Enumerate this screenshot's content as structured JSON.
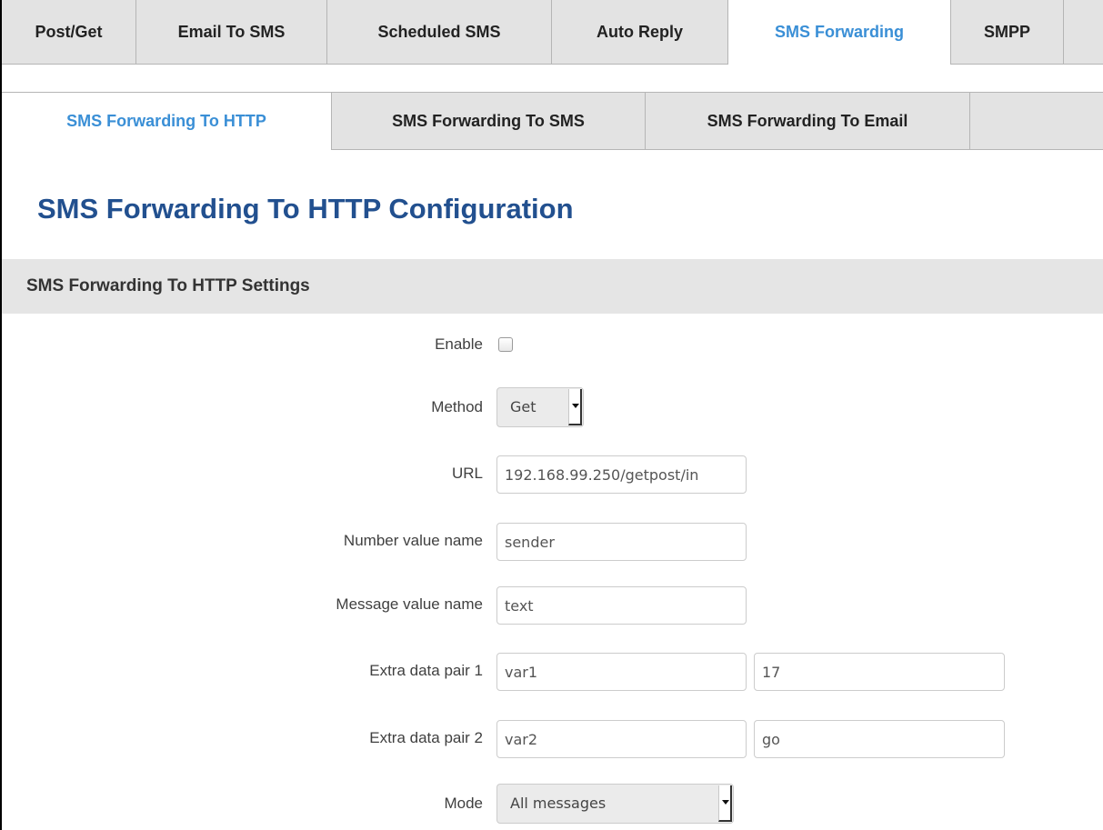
{
  "top_tabs": {
    "items": [
      {
        "label": "Post/Get"
      },
      {
        "label": "Email To SMS"
      },
      {
        "label": "Scheduled SMS"
      },
      {
        "label": "Auto Reply"
      },
      {
        "label": "SMS Forwarding",
        "active": true
      },
      {
        "label": "SMPP"
      }
    ]
  },
  "sub_tabs": {
    "items": [
      {
        "label": "SMS Forwarding To HTTP",
        "active": true
      },
      {
        "label": "SMS Forwarding To SMS"
      },
      {
        "label": "SMS Forwarding To Email"
      }
    ]
  },
  "page": {
    "title": "SMS Forwarding To HTTP Configuration"
  },
  "section": {
    "title": "SMS Forwarding To HTTP Settings"
  },
  "form": {
    "enable": {
      "label": "Enable",
      "checked": false
    },
    "method": {
      "label": "Method",
      "value": "Get"
    },
    "url": {
      "label": "URL",
      "value": "192.168.99.250/getpost/in"
    },
    "number_value_name": {
      "label": "Number value name",
      "value": "sender"
    },
    "message_value_name": {
      "label": "Message value name",
      "value": "text"
    },
    "extra_pair_1": {
      "label": "Extra data pair 1",
      "name": "var1",
      "value": "17"
    },
    "extra_pair_2": {
      "label": "Extra data pair 2",
      "name": "var2",
      "value": "go"
    },
    "mode": {
      "label": "Mode",
      "value": "All messages"
    }
  },
  "colors": {
    "accent": "#3a8fd6",
    "title": "#22508f",
    "tab_bg": "#e3e3e3",
    "section_bg": "#e5e5e5"
  }
}
